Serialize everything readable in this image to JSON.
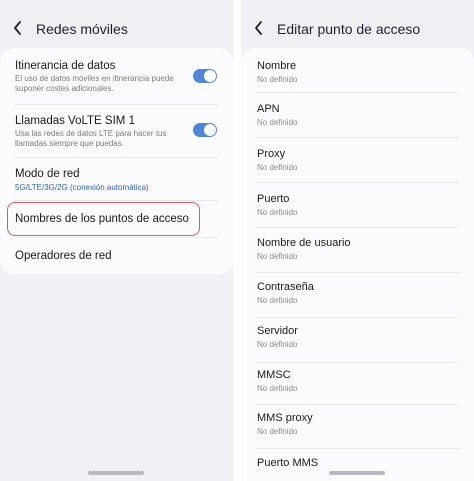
{
  "left": {
    "title": "Redes móviles",
    "rows": [
      {
        "title": "Itinerancia de datos",
        "subtitle": "El uso de datos móviles en itinerancia puede suponer costes adicionales.",
        "toggle_on": true
      },
      {
        "title": "Llamadas VoLTE SIM 1",
        "subtitle": "Usa las redes de datos LTE para hacer tus llamadas siempre que puedas.",
        "toggle_on": true
      },
      {
        "title": "Modo de red",
        "subtitle": "5G/LTE/3G/2G (conexión automática)"
      },
      {
        "title": "Nombres de los puntos de acceso"
      },
      {
        "title": "Operadores de red"
      }
    ]
  },
  "right": {
    "title": "Editar punto de acceso",
    "fields": [
      {
        "label": "Nombre",
        "value": "No definido"
      },
      {
        "label": "APN",
        "value": "No definido"
      },
      {
        "label": "Proxy",
        "value": "No definido"
      },
      {
        "label": "Puerto",
        "value": "No definido"
      },
      {
        "label": "Nombre de usuario",
        "value": "No definido"
      },
      {
        "label": "Contraseña",
        "value": "No definido"
      },
      {
        "label": "Servidor",
        "value": "No definido"
      },
      {
        "label": "MMSC",
        "value": "No definido"
      },
      {
        "label": "MMS proxy",
        "value": "No definido"
      },
      {
        "label": "Puerto MMS",
        "value": ""
      }
    ]
  },
  "colors": {
    "accent": "#4f86d8",
    "highlight": "#d85a66",
    "subtitle_accent": "#2f63bf"
  },
  "icons": {
    "back": "chevron-left-icon"
  }
}
